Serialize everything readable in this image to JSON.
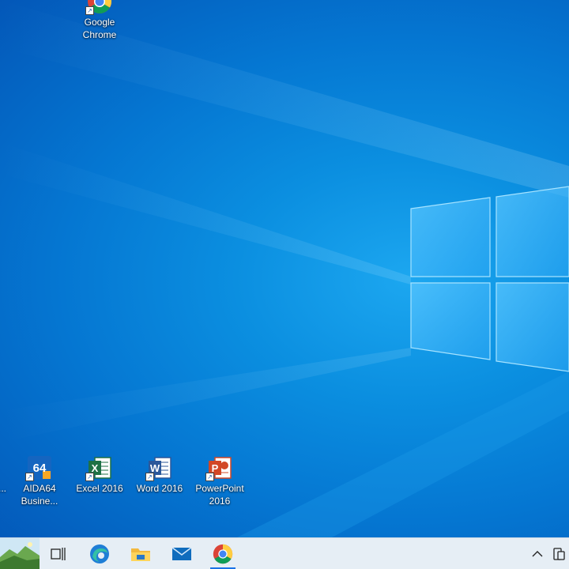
{
  "desktop": {
    "icons": [
      {
        "name": "google-chrome",
        "label": "Google Chrome"
      },
      {
        "name": "partial-app",
        "label": "..."
      },
      {
        "name": "aida64",
        "label": "AIDA64 Busine...",
        "glyph": "64"
      },
      {
        "name": "excel",
        "label": "Excel 2016",
        "glyph": "X"
      },
      {
        "name": "word",
        "label": "Word 2016",
        "glyph": "W"
      },
      {
        "name": "powerpoint",
        "label": "PowerPoint 2016",
        "glyph": "P"
      }
    ]
  },
  "taskbar": {
    "items": [
      {
        "name": "start-search-icon"
      },
      {
        "name": "task-view-icon"
      },
      {
        "name": "edge-icon"
      },
      {
        "name": "file-explorer-icon"
      },
      {
        "name": "mail-icon"
      },
      {
        "name": "chrome-icon",
        "active": true
      }
    ],
    "tray": [
      {
        "name": "show-hidden-icons-icon",
        "glyph": "^"
      },
      {
        "name": "devices-icon"
      }
    ]
  },
  "colors": {
    "excel": "#1e7145",
    "word": "#2b579a",
    "powerpoint": "#d24726",
    "aida64": "#1565c0",
    "accent": "#1a73e8"
  }
}
